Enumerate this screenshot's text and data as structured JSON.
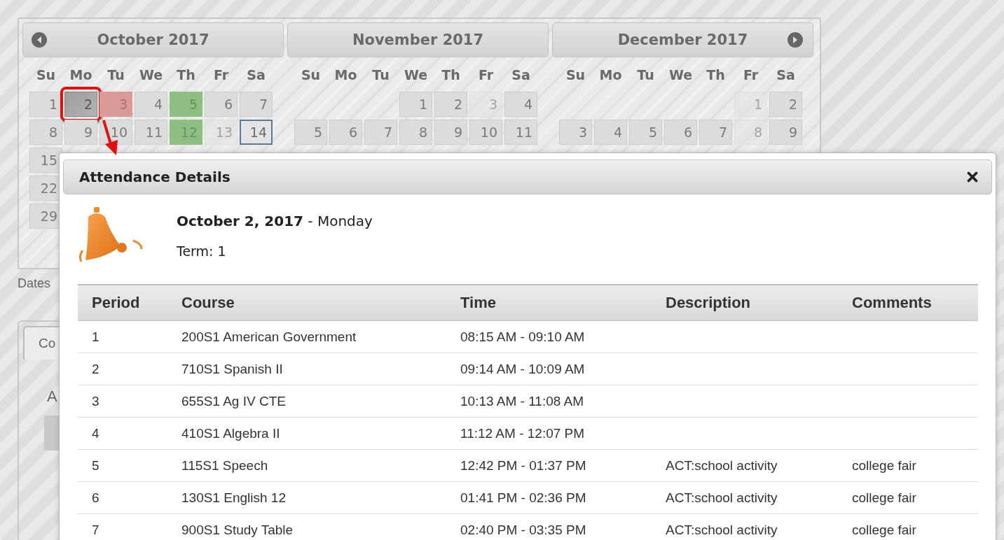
{
  "calendar": {
    "months": [
      {
        "title": "October 2017",
        "weekdays": [
          "Su",
          "Mo",
          "Tu",
          "We",
          "Th",
          "Fr",
          "Sa"
        ],
        "weeks": [
          [
            {
              "day": "1",
              "kind": "normal",
              "selected": false
            },
            {
              "day": "2",
              "kind": "normal",
              "selected": true
            },
            {
              "day": "3",
              "kind": "absent",
              "selected": false
            },
            {
              "day": "4",
              "kind": "normal",
              "selected": false
            },
            {
              "day": "5",
              "kind": "present",
              "selected": false
            },
            {
              "day": "6",
              "kind": "normal",
              "selected": false
            },
            {
              "day": "7",
              "kind": "normal",
              "selected": false
            }
          ],
          [
            {
              "day": "8",
              "kind": "normal",
              "selected": false
            },
            {
              "day": "9",
              "kind": "normal",
              "selected": false
            },
            {
              "day": "10",
              "kind": "normal",
              "selected": false
            },
            {
              "day": "11",
              "kind": "normal",
              "selected": false
            },
            {
              "day": "12",
              "kind": "present",
              "selected": false
            },
            {
              "day": "13",
              "kind": "disabled",
              "selected": false
            },
            {
              "day": "14",
              "kind": "today",
              "selected": false
            }
          ],
          [
            {
              "day": "15",
              "kind": "normal",
              "selected": false
            }
          ],
          [
            {
              "day": "22",
              "kind": "normal",
              "selected": false
            }
          ],
          [
            {
              "day": "29",
              "kind": "normal",
              "selected": false
            }
          ]
        ]
      },
      {
        "title": "November 2017",
        "weekdays": [
          "Su",
          "Mo",
          "Tu",
          "We",
          "Th",
          "Fr",
          "Sa"
        ],
        "weeks": [
          [
            {
              "day": "1",
              "kind": "normal",
              "selected": false
            },
            {
              "day": "2",
              "kind": "normal",
              "selected": false
            },
            {
              "day": "3",
              "kind": "disabled",
              "selected": false
            },
            {
              "day": "4",
              "kind": "normal",
              "selected": false
            }
          ],
          [
            {
              "day": "5",
              "kind": "normal",
              "selected": false
            },
            {
              "day": "6",
              "kind": "normal",
              "selected": false
            },
            {
              "day": "7",
              "kind": "normal",
              "selected": false
            },
            {
              "day": "8",
              "kind": "normal",
              "selected": false
            },
            {
              "day": "9",
              "kind": "normal",
              "selected": false
            },
            {
              "day": "10",
              "kind": "normal",
              "selected": false
            },
            {
              "day": "11",
              "kind": "normal",
              "selected": false
            }
          ]
        ]
      },
      {
        "title": "December 2017",
        "weekdays": [
          "Su",
          "Mo",
          "Tu",
          "We",
          "Th",
          "Fr",
          "Sa"
        ],
        "weeks": [
          [
            {
              "day": "1",
              "kind": "disabled",
              "selected": false
            },
            {
              "day": "2",
              "kind": "normal",
              "selected": false
            }
          ],
          [
            {
              "day": "3",
              "kind": "normal",
              "selected": false
            },
            {
              "day": "4",
              "kind": "normal",
              "selected": false
            },
            {
              "day": "5",
              "kind": "normal",
              "selected": false
            },
            {
              "day": "6",
              "kind": "normal",
              "selected": false
            },
            {
              "day": "7",
              "kind": "normal",
              "selected": false
            },
            {
              "day": "8",
              "kind": "disabled",
              "selected": false
            },
            {
              "day": "9",
              "kind": "normal",
              "selected": false
            }
          ]
        ]
      }
    ]
  },
  "side": {
    "dates_label": "Dates",
    "tab": "Co",
    "label": "A"
  },
  "modal": {
    "title": "Attendance Details",
    "date": "**October 2, 2017** - Monday",
    "term": "Term: 1",
    "columns": [
      "Period",
      "Course",
      "Time",
      "Description",
      "Comments"
    ],
    "rows": [
      {
        "period": "1",
        "course": "200S1 American Government",
        "time": "08:15 AM - 09:10 AM"
      },
      {
        "period": "2",
        "course": "710S1 Spanish II",
        "time": "09:14 AM - 10:09 AM"
      },
      {
        "period": "3",
        "course": "655S1 Ag IV CTE",
        "time": "10:13 AM - 11:08 AM"
      },
      {
        "period": "4",
        "course": "410S1 Algebra II",
        "time": "11:12 AM - 12:07 PM"
      },
      {
        "period": "5",
        "course": "115S1 Speech",
        "time": "12:42 PM - 01:37 PM",
        "description": "ACT:school activity",
        "comments": "college fair"
      },
      {
        "period": "6",
        "course": "130S1 English 12",
        "time": "01:41 PM - 02:36 PM",
        "description": "ACT:school activity",
        "comments": "college fair"
      },
      {
        "period": "7",
        "course": "900S1 Study Table",
        "time": "02:40 PM - 03:35 PM",
        "description": "ACT:school activity",
        "comments": "college fair"
      }
    ]
  }
}
